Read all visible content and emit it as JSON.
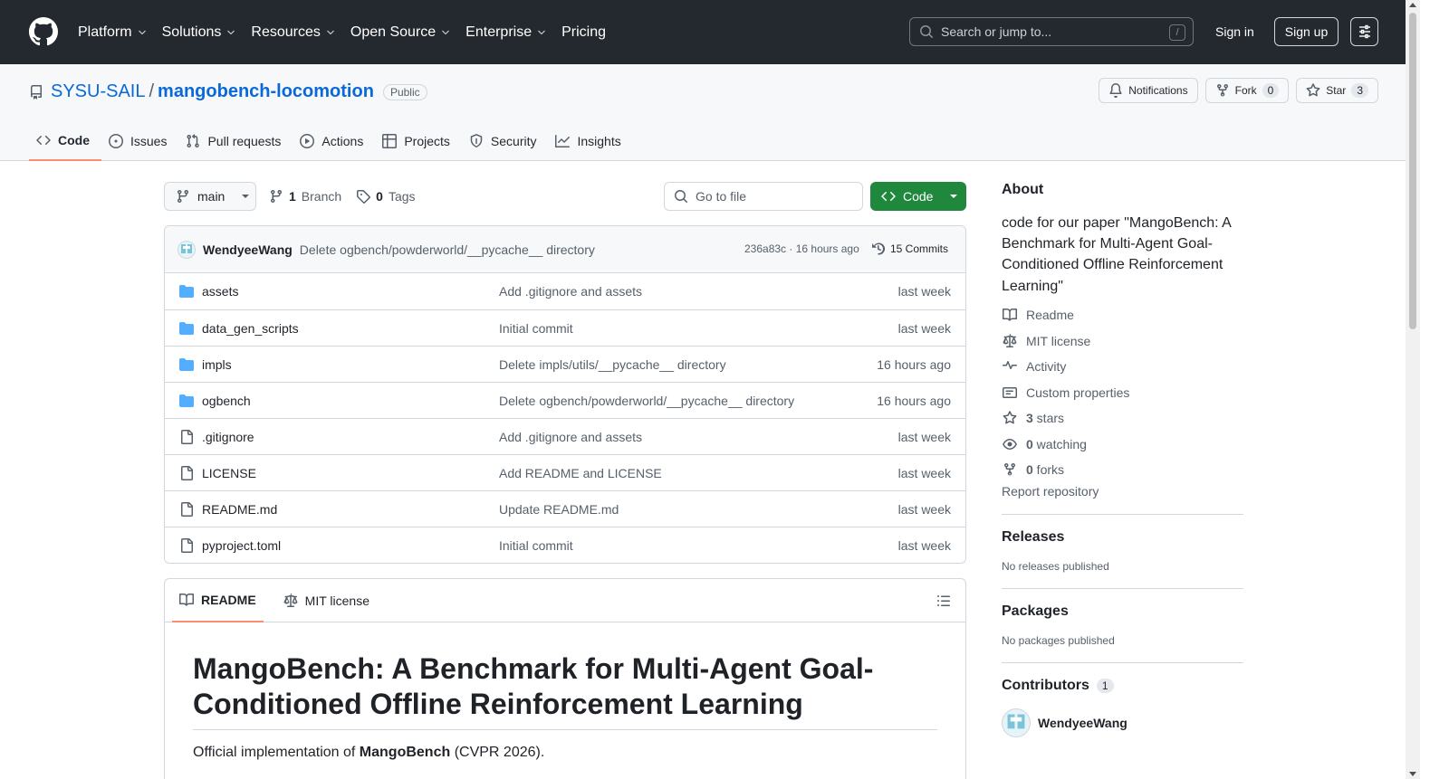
{
  "header": {
    "nav": [
      {
        "label": "Platform",
        "has_menu": true
      },
      {
        "label": "Solutions",
        "has_menu": true
      },
      {
        "label": "Resources",
        "has_menu": true
      },
      {
        "label": "Open Source",
        "has_menu": true
      },
      {
        "label": "Enterprise",
        "has_menu": true
      },
      {
        "label": "Pricing",
        "has_menu": false
      }
    ],
    "search_placeholder": "Search or jump to...",
    "search_shortcut": "/",
    "signin": "Sign in",
    "signup": "Sign up"
  },
  "repo": {
    "owner": "SYSU-SAIL",
    "separator": "/",
    "name": "mangobench-locomotion",
    "visibility": "Public",
    "notifications": "Notifications",
    "fork_label": "Fork",
    "fork_count": "0",
    "star_label": "Star",
    "star_count": "3"
  },
  "tabs": [
    {
      "label": "Code",
      "icon": "code-icon",
      "active": true
    },
    {
      "label": "Issues",
      "icon": "issue-icon"
    },
    {
      "label": "Pull requests",
      "icon": "pull-request-icon"
    },
    {
      "label": "Actions",
      "icon": "play-icon"
    },
    {
      "label": "Projects",
      "icon": "table-icon"
    },
    {
      "label": "Security",
      "icon": "shield-icon"
    },
    {
      "label": "Insights",
      "icon": "graph-icon"
    }
  ],
  "toolbar": {
    "branch": "main",
    "branch_count": "1",
    "branch_label": "Branch",
    "tag_count": "0",
    "tag_label": "Tags",
    "goto_placeholder": "Go to file",
    "code_button": "Code"
  },
  "latest_commit": {
    "author": "WendyeeWang",
    "message": "Delete ogbench/powderworld/__pycache__ directory",
    "sha_time": "236a83c · 16 hours ago",
    "commits": "15 Commits"
  },
  "files": [
    {
      "name": "assets",
      "type": "folder",
      "message": "Add .gitignore and assets",
      "time": "last week"
    },
    {
      "name": "data_gen_scripts",
      "type": "folder",
      "message": "Initial commit",
      "time": "last week"
    },
    {
      "name": "impls",
      "type": "folder",
      "message": "Delete impls/utils/__pycache__ directory",
      "time": "16 hours ago"
    },
    {
      "name": "ogbench",
      "type": "folder",
      "message": "Delete ogbench/powderworld/__pycache__ directory",
      "time": "16 hours ago"
    },
    {
      "name": ".gitignore",
      "type": "file",
      "message": "Add .gitignore and assets",
      "time": "last week"
    },
    {
      "name": "LICENSE",
      "type": "file",
      "message": "Add README and LICENSE",
      "time": "last week"
    },
    {
      "name": "README.md",
      "type": "file",
      "message": "Update README.md",
      "time": "last week"
    },
    {
      "name": "pyproject.toml",
      "type": "file",
      "message": "Initial commit",
      "time": "last week"
    }
  ],
  "readme": {
    "tab_readme": "README",
    "tab_license": "MIT license",
    "title": "MangoBench: A Benchmark for Multi-Agent Goal-Conditioned Offline Reinforcement Learning",
    "intro_before": "Official implementation of ",
    "intro_bold": "MangoBench",
    "intro_after": " (CVPR 2026)."
  },
  "sidebar": {
    "about_title": "About",
    "description": "code for our paper \"MangoBench: A Benchmark for Multi-Agent Goal-Conditioned Offline Reinforcement Learning\"",
    "links": [
      {
        "icon": "book-icon",
        "bold": "",
        "text": "Readme"
      },
      {
        "icon": "law-icon",
        "bold": "",
        "text": "MIT license"
      },
      {
        "icon": "pulse-icon",
        "bold": "",
        "text": "Activity"
      },
      {
        "icon": "note-icon",
        "bold": "",
        "text": "Custom properties"
      },
      {
        "icon": "star-icon",
        "bold": "3",
        "text": " stars"
      },
      {
        "icon": "eye-icon",
        "bold": "0",
        "text": " watching"
      },
      {
        "icon": "fork-icon",
        "bold": "0",
        "text": " forks"
      }
    ],
    "report": "Report repository",
    "releases_title": "Releases",
    "releases_text": "No releases published",
    "packages_title": "Packages",
    "packages_text": "No packages published",
    "contributors_title": "Contributors",
    "contributors_count": "1",
    "contributor_name": "WendyeeWang"
  },
  "colors": {
    "header_bg": "#24292f",
    "link": "#0969da",
    "primary_button": "#1f883d",
    "active_tab_underline": "#fd8c73",
    "folder": "#54aeff"
  }
}
